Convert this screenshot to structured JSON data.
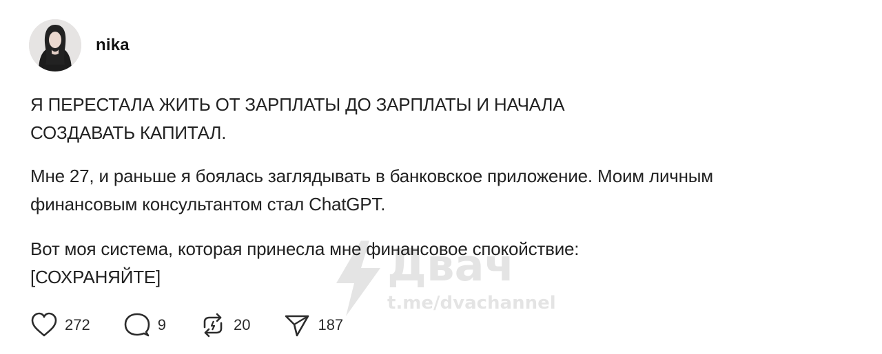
{
  "post": {
    "author": {
      "username": "nika"
    },
    "paragraphs": [
      [
        "Я ПЕРЕСТАЛА ЖИТЬ ОТ ЗАРПЛАТЫ ДО ЗАРПЛАТЫ И НАЧАЛА",
        "СОЗДАВАТЬ КАПИТАЛ."
      ],
      [
        "Мне 27, и раньше я боялась заглядывать в банковское приложение. Моим личным",
        "финансовым консультантом стал ChatGPT."
      ],
      [
        "Вот моя система, которая принесла мне финансовое спокойствие:",
        "[СОХРАНЯЙТЕ]"
      ]
    ],
    "actions": {
      "like": {
        "icon": "heart-icon",
        "count": "272"
      },
      "comment": {
        "icon": "comment-icon",
        "count": "9"
      },
      "repost": {
        "icon": "repost-icon",
        "count": "20"
      },
      "share": {
        "icon": "share-icon",
        "count": "187"
      }
    }
  },
  "watermark": {
    "logo": "Двач",
    "url": "t.me/dvachannel"
  }
}
